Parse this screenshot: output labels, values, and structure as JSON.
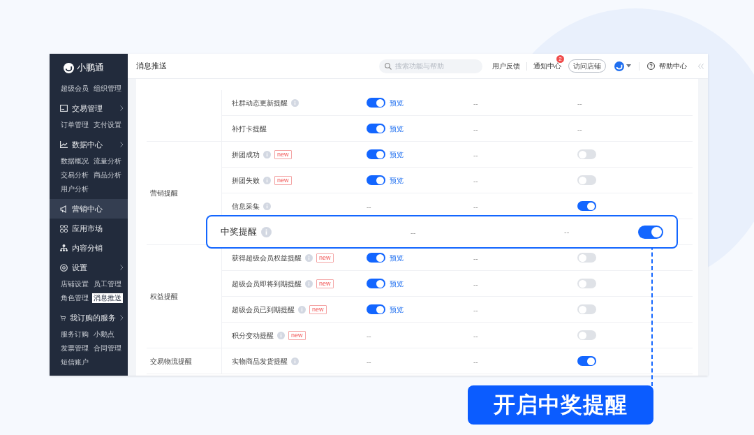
{
  "sidebar": {
    "brand": "小鹏通",
    "items": [
      {
        "kind": "links",
        "links": [
          {
            "label": "超级会员",
            "selected": false
          },
          {
            "label": "组织管理",
            "selected": false
          }
        ]
      },
      {
        "kind": "section",
        "label": "交易管理",
        "chevron": true,
        "selected": false
      },
      {
        "kind": "links",
        "links": [
          {
            "label": "订单管理",
            "selected": false
          },
          {
            "label": "支付设置",
            "selected": false
          }
        ]
      },
      {
        "kind": "section",
        "label": "数据中心",
        "chevron": true,
        "selected": false
      },
      {
        "kind": "links",
        "links": [
          {
            "label": "数据概况",
            "selected": false
          },
          {
            "label": "流量分析",
            "selected": false
          },
          {
            "label": "交易分析",
            "selected": false
          },
          {
            "label": "商品分析",
            "selected": false
          },
          {
            "label": "用户分析",
            "selected": false
          }
        ]
      },
      {
        "kind": "section",
        "label": "营销中心",
        "chevron": false,
        "selected": true
      },
      {
        "kind": "section",
        "label": "应用市场",
        "chevron": false,
        "selected": false
      },
      {
        "kind": "section",
        "label": "内容分销",
        "chevron": false,
        "selected": false
      },
      {
        "kind": "section",
        "label": "设置",
        "chevron": true,
        "selected": false
      },
      {
        "kind": "links",
        "links": [
          {
            "label": "店铺设置",
            "selected": false
          },
          {
            "label": "员工管理",
            "selected": false
          },
          {
            "label": "角色管理",
            "selected": false
          },
          {
            "label": "消息推送",
            "selected": true
          }
        ]
      },
      {
        "kind": "section",
        "label": "我订购的服务",
        "chevron": true,
        "selected": false
      },
      {
        "kind": "links",
        "links": [
          {
            "label": "服务订购",
            "selected": false
          },
          {
            "label": "小鹅点",
            "selected": false
          },
          {
            "label": "发票管理",
            "selected": false
          },
          {
            "label": "合同管理",
            "selected": false
          },
          {
            "label": "短信账户",
            "selected": false
          }
        ]
      }
    ]
  },
  "header": {
    "title": "消息推送",
    "search": {
      "placeholder": "搜索功能与帮助"
    },
    "feedback": "用户反馈",
    "notifications": {
      "label": "通知中心",
      "count": "2"
    },
    "visit_store": "访问店铺",
    "help": "帮助中心"
  },
  "table": {
    "groups": [
      {
        "rows": [
          {
            "name": "社群动态更新提醒",
            "info": true,
            "column_3": {
              "kind": "toggle",
              "on": true,
              "link": "预览"
            },
            "column_4": "--",
            "column_5": {
              "kind": "text",
              "text": "--"
            }
          },
          {
            "name": "补打卡提醒",
            "info": false,
            "column_3": {
              "kind": "toggle",
              "on": true,
              "link": "预览"
            },
            "column_4": "--",
            "column_5": {
              "kind": "text",
              "text": "--"
            }
          }
        ]
      },
      {
        "name": "营销提醒",
        "rows": [
          {
            "name": "拼团成功",
            "info": true,
            "badge": "new",
            "column_3": {
              "kind": "toggle",
              "on": true,
              "link": "预览"
            },
            "column_4": "--",
            "column_5": {
              "kind": "toggle",
              "on": false
            }
          },
          {
            "name": "拼团失败",
            "info": true,
            "badge": "new",
            "column_3": {
              "kind": "toggle",
              "on": true,
              "link": "预览"
            },
            "column_4": "--",
            "column_5": {
              "kind": "toggle",
              "on": false
            }
          },
          {
            "name": "信息采集",
            "info": true,
            "column_3": {
              "kind": "text",
              "text": "--"
            },
            "column_4": "--",
            "column_5": {
              "kind": "toggle",
              "on": true
            }
          },
          {
            "name": "中奖提醒",
            "info": true,
            "highlighted": true,
            "column_3": {
              "kind": "text",
              "text": "--"
            },
            "column_4": "--",
            "column_5": {
              "kind": "toggle",
              "on": true
            }
          }
        ]
      },
      {
        "name": "权益提醒",
        "rows": [
          {
            "name": "获得超级会员权益提醒",
            "info": true,
            "badge": "new",
            "column_3": {
              "kind": "toggle",
              "on": true,
              "link": "预览"
            },
            "column_4": "--",
            "column_5": {
              "kind": "toggle",
              "on": false
            }
          },
          {
            "name": "超级会员即将到期提醒",
            "info": true,
            "badge": "new",
            "column_3": {
              "kind": "toggle",
              "on": true,
              "link": "预览"
            },
            "column_4": "--",
            "column_5": {
              "kind": "toggle",
              "on": false
            }
          },
          {
            "name": "超级会员已到期提醒",
            "info": true,
            "badge": "new",
            "column_3": {
              "kind": "toggle",
              "on": true,
              "link": "预览"
            },
            "column_4": "--",
            "column_5": {
              "kind": "toggle",
              "on": false
            }
          },
          {
            "name": "积分变动提醒",
            "info": true,
            "badge": "new",
            "column_3": {
              "kind": "text",
              "text": "--"
            },
            "column_4": "--",
            "column_5": {
              "kind": "toggle",
              "on": false
            }
          }
        ]
      },
      {
        "name": "交易物流提醒",
        "rows": [
          {
            "name": "实物商品发货提醒",
            "info": true,
            "column_3": {
              "kind": "text",
              "text": "--"
            },
            "column_4": "--",
            "column_5": {
              "kind": "toggle",
              "on": true
            }
          }
        ]
      }
    ]
  },
  "caption": "开启中奖提醒"
}
